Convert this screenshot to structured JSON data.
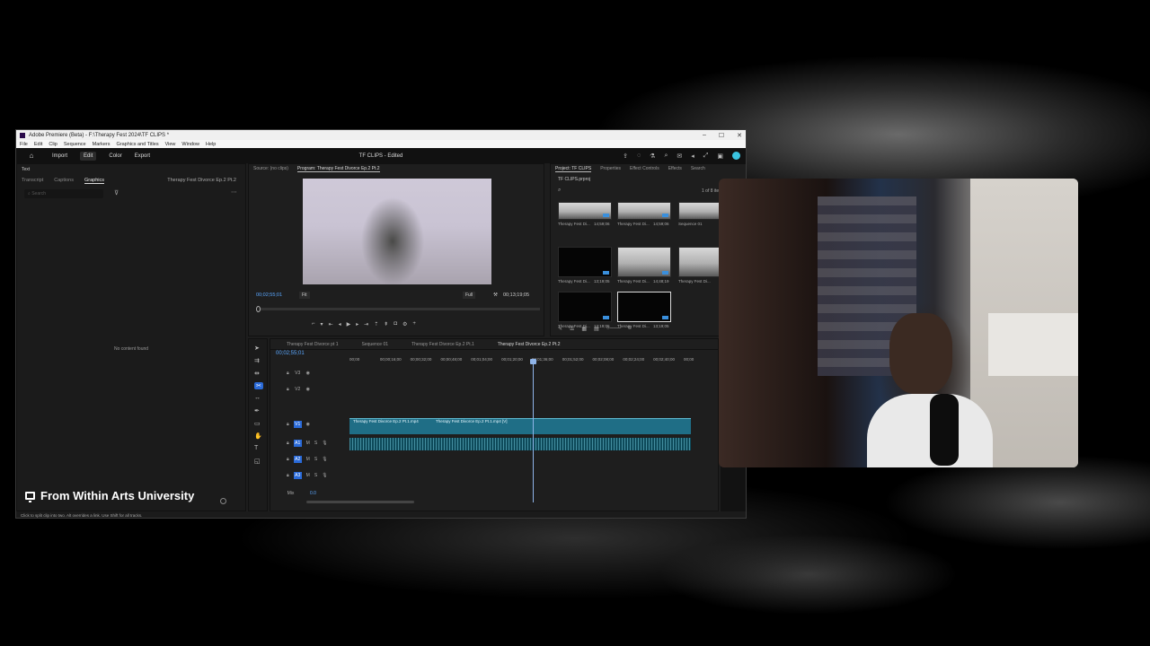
{
  "window": {
    "title": "Adobe Premiere (Beta) - F:\\Therapy Fest 2024\\TF CLIPS *",
    "controls": [
      "–",
      "☐",
      "✕"
    ]
  },
  "menu": [
    "File",
    "Edit",
    "Clip",
    "Sequence",
    "Markers",
    "Graphics and Titles",
    "View",
    "Window",
    "Help"
  ],
  "appbar": {
    "tabs": [
      "Import",
      "Edit",
      "Color",
      "Export"
    ],
    "active_tab": "Edit",
    "project_title": "TF CLIPS - Edited"
  },
  "text_panel": {
    "header": "Text",
    "tabs": [
      "Transcript",
      "Captions",
      "Graphics"
    ],
    "active_tab": "Graphics",
    "sequence_name": "Therapy Fest Divorce Ep.2 Pt.2",
    "search_placeholder": "Search",
    "empty_message": "No content found"
  },
  "monitor": {
    "tabs": [
      "Source: (no clips)",
      "Program: Therapy Fest Divorce Ep.2 Pt.2"
    ],
    "timecode": "00;02;55;01",
    "fit": "Fit",
    "quality": "Full",
    "duration": "00;13;19;05"
  },
  "project": {
    "tabs": [
      "Project: TF CLIPS",
      "Properties",
      "Effect Controls",
      "Effects",
      "Search"
    ],
    "path": "TF CLIPS.prproj",
    "count": "1 of 8 items",
    "items": [
      {
        "label": "Therapy Fest Di...",
        "duration": "14;59;06",
        "img": true
      },
      {
        "label": "Therapy Fest Di...",
        "duration": "14;59;06",
        "img": true
      },
      {
        "label": "Sequence 01",
        "duration": "",
        "img": true
      },
      {
        "label": "Therapy Fest Di...",
        "duration": "13;19;05",
        "img": false
      },
      {
        "label": "Therapy Fest Di...",
        "duration": "14;48;19",
        "img": true
      },
      {
        "label": "Therapy Fest Di...",
        "duration": "",
        "img": true
      },
      {
        "label": "Therapy Fest Di...",
        "duration": "13;19;05",
        "img": false
      },
      {
        "label": "Therapy Fest Di...",
        "duration": "13;19;05",
        "img": false
      }
    ]
  },
  "timeline": {
    "tabs": [
      "Therapy Fest Divorce pt 1",
      "Sequence 01",
      "Therapy Fest Divorce Ep.2 Pt.1",
      "Therapy Fest Divorce Ep.2 Pt.2"
    ],
    "active_tab": "Therapy Fest Divorce Ep.2 Pt.2",
    "timecode": "00;02;55;01",
    "ruler": [
      "00;00",
      "00;00;16;00",
      "00;00;32;00",
      "00;00;48;00",
      "00;01;04;00",
      "00;01;20;00",
      "00;01;36;00",
      "00;01;52;00",
      "00;02;08;00",
      "00;02;24;00",
      "00;02;40;00",
      "00;00"
    ],
    "tracks": [
      "V3",
      "V2",
      "V1",
      "A1",
      "A2",
      "A3",
      "Mix"
    ],
    "mix_value": "0.0",
    "clip1": "Therapy Fest Divorce Ep.2 Pt.1.mp4",
    "clip2": "Therapy Fest Divorce Ep.2 Pt.1.mp4 [V]"
  },
  "status": "Click to split clip into two. Alt overrides a link. Use Shift for all tracks.",
  "watermark": "From Within Arts University"
}
